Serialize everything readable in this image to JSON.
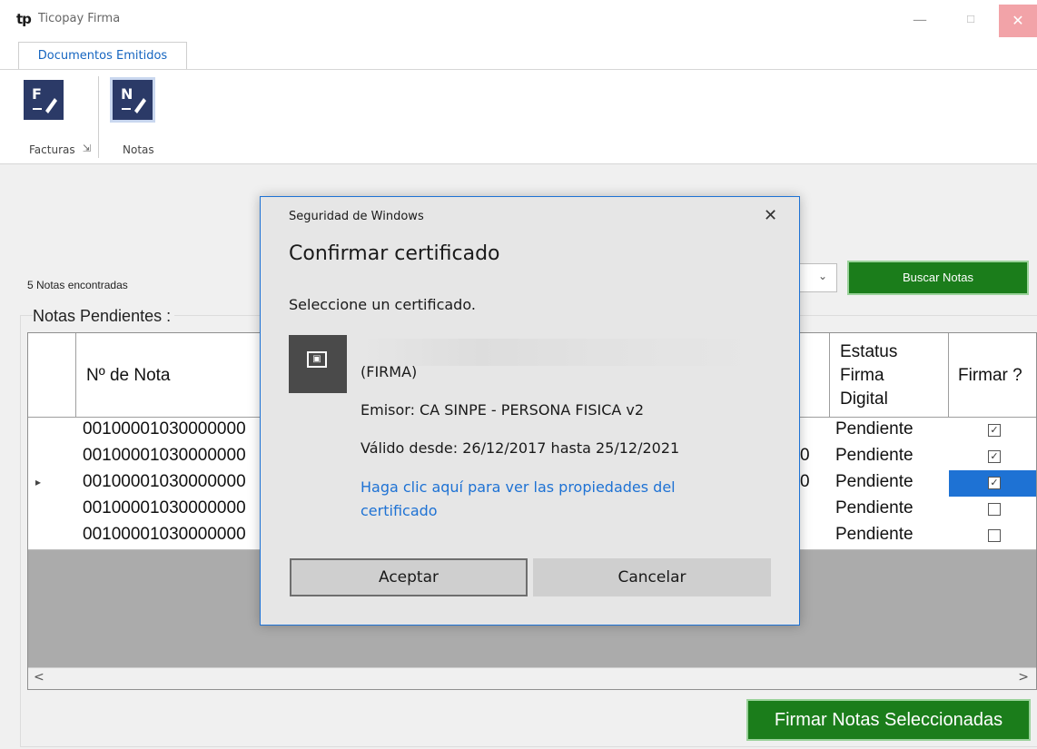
{
  "app": {
    "logo_text": "tp",
    "title": "Ticopay Firma",
    "minimize_glyph": "—",
    "maximize_glyph": "☐",
    "close_glyph": "✕"
  },
  "ribbon": {
    "tab_label": "Documentos Emitidos",
    "items": [
      {
        "icon_letter": "F",
        "label": "Facturas",
        "selected": false
      },
      {
        "icon_letter": "N",
        "label": "Notas",
        "selected": true
      }
    ],
    "launcher_glyph": "⇲"
  },
  "main": {
    "found_text": "5 Notas encontradas",
    "group_label": "Notas Pendientes :",
    "combo_arrow": "⌄",
    "search_button": "Buscar Notas",
    "sign_button": "Firmar Notas Seleccionadas"
  },
  "grid": {
    "columns": {
      "nota": "Nº de Nota",
      "estatus_lines": [
        "Estatus",
        "Firma",
        "Digital"
      ],
      "firmar": "Firmar ?"
    },
    "rows": [
      {
        "nota": "00100001030000000",
        "partial": "",
        "estatus": "Pendiente",
        "firmar": true,
        "current": false
      },
      {
        "nota": "00100001030000000",
        "partial": "0",
        "estatus": "Pendiente",
        "firmar": true,
        "current": false
      },
      {
        "nota": "00100001030000000",
        "partial": "0",
        "estatus": "Pendiente",
        "firmar": true,
        "current": true
      },
      {
        "nota": "00100001030000000",
        "partial": "",
        "estatus": "Pendiente",
        "firmar": false,
        "current": false
      },
      {
        "nota": "00100001030000000",
        "partial": "",
        "estatus": "Pendiente",
        "firmar": false,
        "current": false
      }
    ],
    "row_indicator": "▸",
    "scroll_left": "<",
    "scroll_right": ">"
  },
  "dialog": {
    "subtitle": "Seguridad de Windows",
    "close_glyph": "✕",
    "title": "Confirmar certificado",
    "prompt": "Seleccione un certificado.",
    "cert_name": "(FIRMA)",
    "emisor": "Emisor: CA SINPE - PERSONA FISICA v2",
    "valid": "Válido desde: 26/12/2017 hasta 25/12/2021",
    "link": "Haga clic aquí para ver las propiedades del certificado",
    "accept": "Aceptar",
    "cancel": "Cancelar"
  },
  "colors": {
    "accent": "#1e72d4",
    "green_button": "#1b7d1b",
    "ribbon_icon": "#2b3a67"
  }
}
